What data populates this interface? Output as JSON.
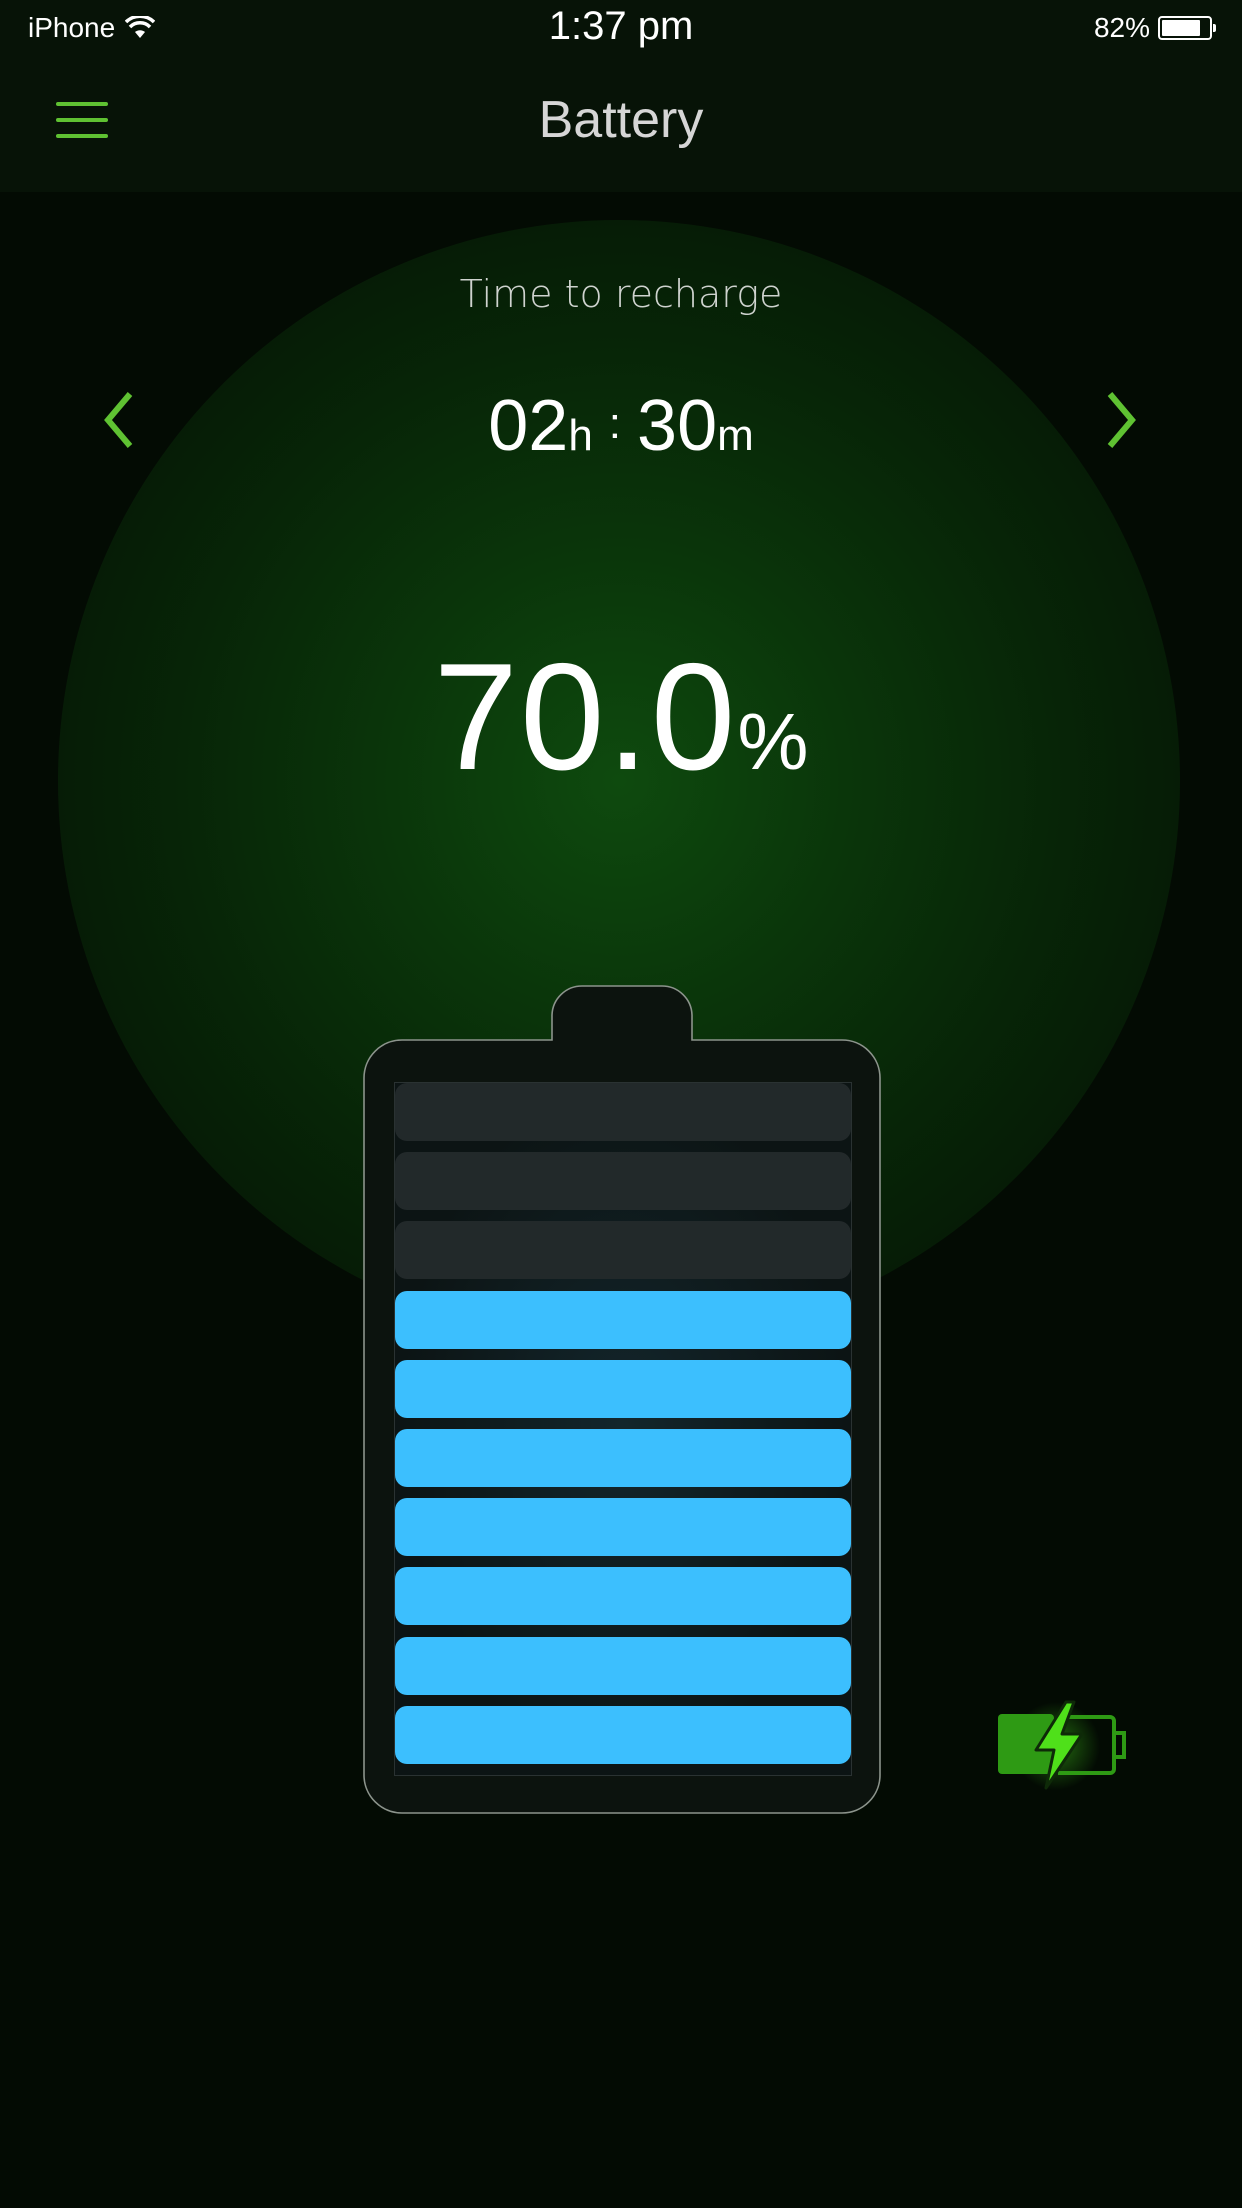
{
  "status_bar": {
    "carrier": "iPhone",
    "wifi_icon": "wifi-icon",
    "time": "1:37 pm",
    "battery_percent": "82%",
    "battery_level": 0.82
  },
  "nav": {
    "menu_icon": "hamburger-menu-icon",
    "title": "Battery"
  },
  "recharge": {
    "label": "Time to recharge",
    "hours": "02",
    "hours_unit": "h",
    "separator": ":",
    "minutes": "30",
    "minutes_unit": "m",
    "prev_icon": "chevron-left-icon",
    "next_icon": "chevron-right-icon"
  },
  "charge": {
    "value": "70.0",
    "unit": "%",
    "level_percent": 70,
    "total_cells": 10,
    "filled_cells": 7
  },
  "indicator": {
    "icon": "charging-battery-icon"
  },
  "colors": {
    "accent_green": "#5fc232",
    "cell_filled": "#3cbffe",
    "cell_empty": "#22292a",
    "charging_green": "#4fe01a"
  }
}
